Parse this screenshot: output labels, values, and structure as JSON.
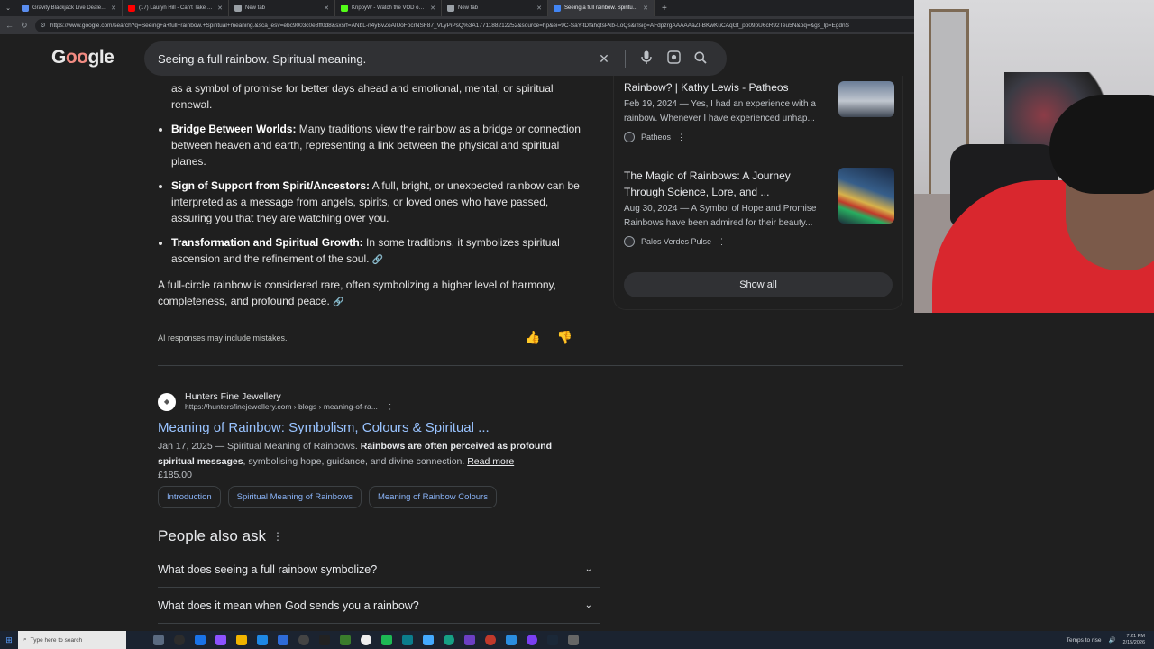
{
  "browser": {
    "tabs": [
      {
        "title": "Gravity Blackjack Live Dealer Game",
        "color": "#5a8dee",
        "active": false
      },
      {
        "title": "(17) Lauryn Hill - Can't Take My Eyes",
        "color": "#ff0000",
        "active": false
      },
      {
        "title": "New tab",
        "color": "#9aa0a6",
        "active": false
      },
      {
        "title": "KrippyW - Watch the VOD on Kick",
        "color": "#53fc18",
        "active": false
      },
      {
        "title": "New tab",
        "color": "#9aa0a6",
        "active": false
      },
      {
        "title": "Seeing a full rainbow. Spiritual m...",
        "color": "#4285f4",
        "active": true
      }
    ],
    "new_tab_icon": "+",
    "url": "https://www.google.com/search?q=Seeing+a+full+rainbow.+Spiritual+meaning.&sca_esv=ebc9003c0e8ff0d8&sxsrf=ANbL-n4yBvZoAlUoFocrNSF87_VLyPiPsQ%3A1771188212252&source=hp&ei=9C-SaY-tDfahqtsPkb-LoQs&iflsig=AFdpzrgAAAAAaZI-BKwKuCAqGt_pp09pU6cR92Teu5N&oq=&gs_lp=EgdnS"
  },
  "google": {
    "logo": "Google",
    "search_query": "Seeing a full rainbow. Spiritual meaning.",
    "icons": {
      "clear": "close-icon",
      "voice": "microphone-icon",
      "lens": "camera-lens-icon",
      "search": "search-icon"
    }
  },
  "ai_overview": {
    "intro_tail": "as a symbol of promise for better days ahead and emotional, mental, or spiritual renewal.",
    "bullets": [
      {
        "bold": "Bridge Between Worlds:",
        "text": " Many traditions view the rainbow as a bridge or connection between heaven and earth, representing a link between the physical and spiritual planes."
      },
      {
        "bold": "Sign of Support from Spirit/Ancestors:",
        "text": " A full, bright, or unexpected rainbow can be interpreted as a message from angels, spirits, or loved ones who have passed, assuring you that they are watching over you."
      },
      {
        "bold": "Transformation and Spiritual Growth:",
        "text": " In some traditions, it symbolizes spiritual ascension and the refinement of the soul."
      }
    ],
    "closing": "A full-circle rainbow is considered rare, often symbolizing a higher level of harmony, completeness, and profound peace.",
    "disclaimer": "AI responses may include mistakes."
  },
  "sources": [
    {
      "title": "Rainbow? | Kathy Lewis - Patheos",
      "desc": "Feb 19, 2024 — Yes, I had an experience with a rainbow. Whenever I have experienced unhap...",
      "site": "Patheos"
    },
    {
      "title": "The Magic of Rainbows: A Journey Through Science, Lore, and ...",
      "desc": "Aug 30, 2024 — A Symbol of Hope and Promise Rainbows have been admired for their beauty...",
      "site": "Palos Verdes Pulse"
    }
  ],
  "show_all": "Show all",
  "result": {
    "site_name": "Hunters Fine Jewellery",
    "crumb": "https://huntersfinejewellery.com › blogs › meaning-of-ra...",
    "title": "Meaning of Rainbow: Symbolism, Colours & Spiritual ...",
    "date": "Jan 17, 2025",
    "snip_plain": " — Spiritual Meaning of Rainbows. ",
    "snip_bold": "Rainbows are often perceived as profound spiritual messages",
    "snip_tail": ", symbolising hope, guidance, and divine connection. ",
    "read_more": "Read more",
    "price": "£185.00",
    "chips": [
      "Introduction",
      "Spiritual Meaning of Rainbows",
      "Meaning of Rainbow Colours"
    ]
  },
  "people_also_ask": {
    "title": "People also ask",
    "questions": [
      "What does seeing a full rainbow symbolize?",
      "What does it mean when God sends you a rainbow?"
    ]
  },
  "taskbar": {
    "search_placeholder": "Type here to search",
    "weather": "Temps to rise",
    "time": "7:21 PM",
    "date": "2/15/2026"
  }
}
